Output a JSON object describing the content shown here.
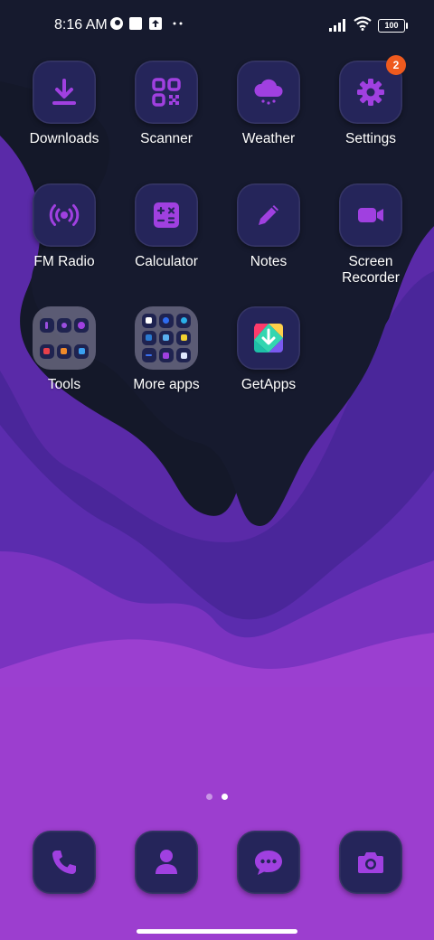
{
  "status_bar": {
    "time": "8:16 AM",
    "battery": "100"
  },
  "colors": {
    "icon_purple": "#a040e0",
    "tile_bg": "#25255a",
    "badge": "#ef5a1e",
    "wallpaper_dark": "#161a2e",
    "wallpaper_purple": "#9b3fd0"
  },
  "apps": {
    "downloads": {
      "label": "Downloads",
      "icon": "download-icon"
    },
    "scanner": {
      "label": "Scanner",
      "icon": "qr-scanner-icon"
    },
    "weather": {
      "label": "Weather",
      "icon": "weather-cloud-icon"
    },
    "settings": {
      "label": "Settings",
      "icon": "gear-icon",
      "badge": "2"
    },
    "fm_radio": {
      "label": "FM Radio",
      "icon": "radio-icon"
    },
    "calculator": {
      "label": "Calculator",
      "icon": "calculator-icon"
    },
    "notes": {
      "label": "Notes",
      "icon": "pencil-icon"
    },
    "screen_recorder": {
      "label": "Screen Recorder",
      "icon": "video-camera-icon"
    },
    "tools": {
      "label": "Tools",
      "icon": "folder-icon"
    },
    "more_apps": {
      "label": "More apps",
      "icon": "folder-icon"
    },
    "getapps": {
      "label": "GetApps",
      "icon": "getapps-icon"
    }
  },
  "dock": [
    {
      "name": "Phone",
      "icon": "phone-icon"
    },
    {
      "name": "Contacts",
      "icon": "contact-icon"
    },
    {
      "name": "Messages",
      "icon": "message-icon"
    },
    {
      "name": "Camera",
      "icon": "camera-icon"
    }
  ],
  "page_indicator": {
    "pages": 2,
    "current": 2
  }
}
